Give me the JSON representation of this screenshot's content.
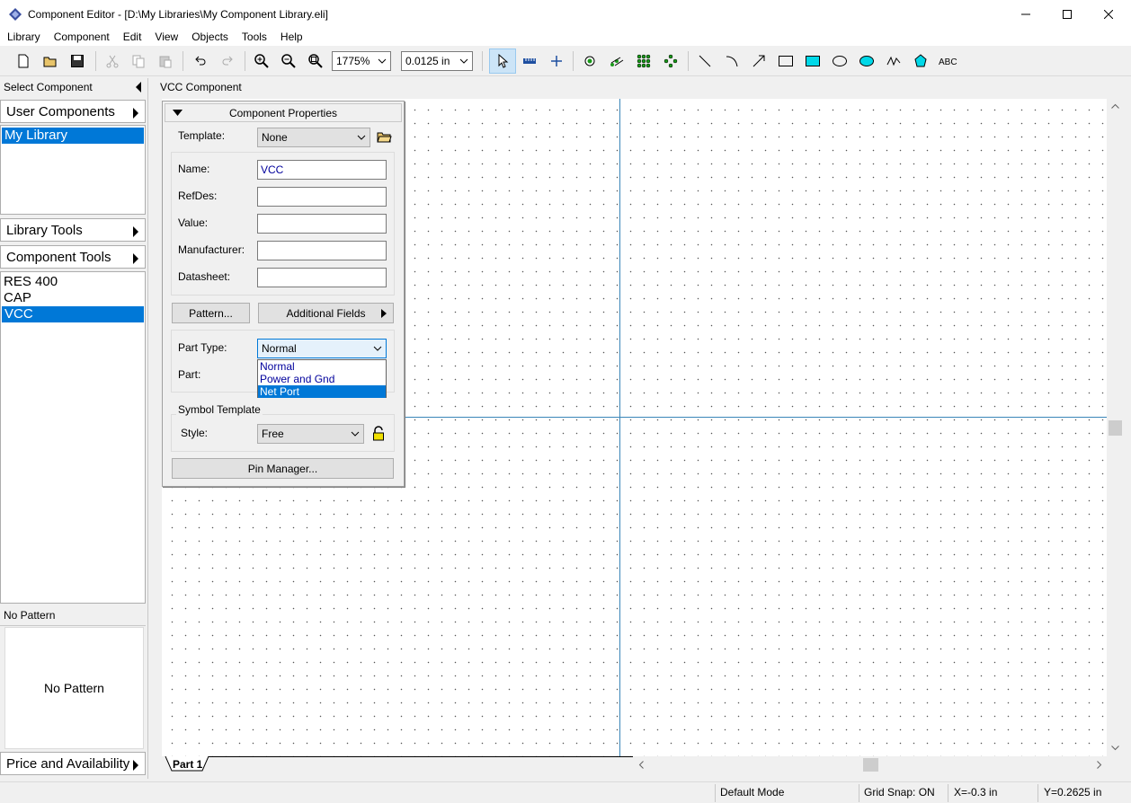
{
  "window": {
    "title": "Component Editor - [D:\\My Libraries\\My Component Library.eli]"
  },
  "menu": [
    "Library",
    "Component",
    "Edit",
    "View",
    "Objects",
    "Tools",
    "Help"
  ],
  "toolbar": {
    "zoom": "1775%",
    "grid": "0.0125 in"
  },
  "left_panel": {
    "header": "Select Component",
    "user_components": "User Components",
    "libraries": [
      "My Library"
    ],
    "library_tools": "Library Tools",
    "component_tools": "Component Tools",
    "components": [
      "RES 400",
      "CAP",
      "VCC"
    ],
    "pattern_header": "No Pattern",
    "pattern_preview": "No Pattern",
    "price_availability": "Price and Availability"
  },
  "canvas": {
    "title": "VCC Component",
    "tab": "Part 1"
  },
  "properties": {
    "header": "Component Properties",
    "template_label": "Template:",
    "template_value": "None",
    "name_label": "Name:",
    "name_value": "VCC",
    "refdes_label": "RefDes:",
    "refdes_value": "",
    "value_label": "Value:",
    "value_value": "",
    "manufacturer_label": "Manufacturer:",
    "manufacturer_value": "",
    "datasheet_label": "Datasheet:",
    "datasheet_value": "",
    "pattern_button": "Pattern...",
    "additional_fields_button": "Additional Fields",
    "part_type_label": "Part Type:",
    "part_type_value": "Normal",
    "part_type_options": [
      "Normal",
      "Power and Gnd",
      "Net Port"
    ],
    "part_label": "Part:",
    "symbol_template_label": "Symbol Template",
    "style_label": "Style:",
    "style_value": "Free",
    "pin_manager_button": "Pin Manager..."
  },
  "status": {
    "mode": "Default Mode",
    "grid_snap": "Grid Snap: ON",
    "x": "X=-0.3 in",
    "y": "Y=0.2625 in"
  }
}
